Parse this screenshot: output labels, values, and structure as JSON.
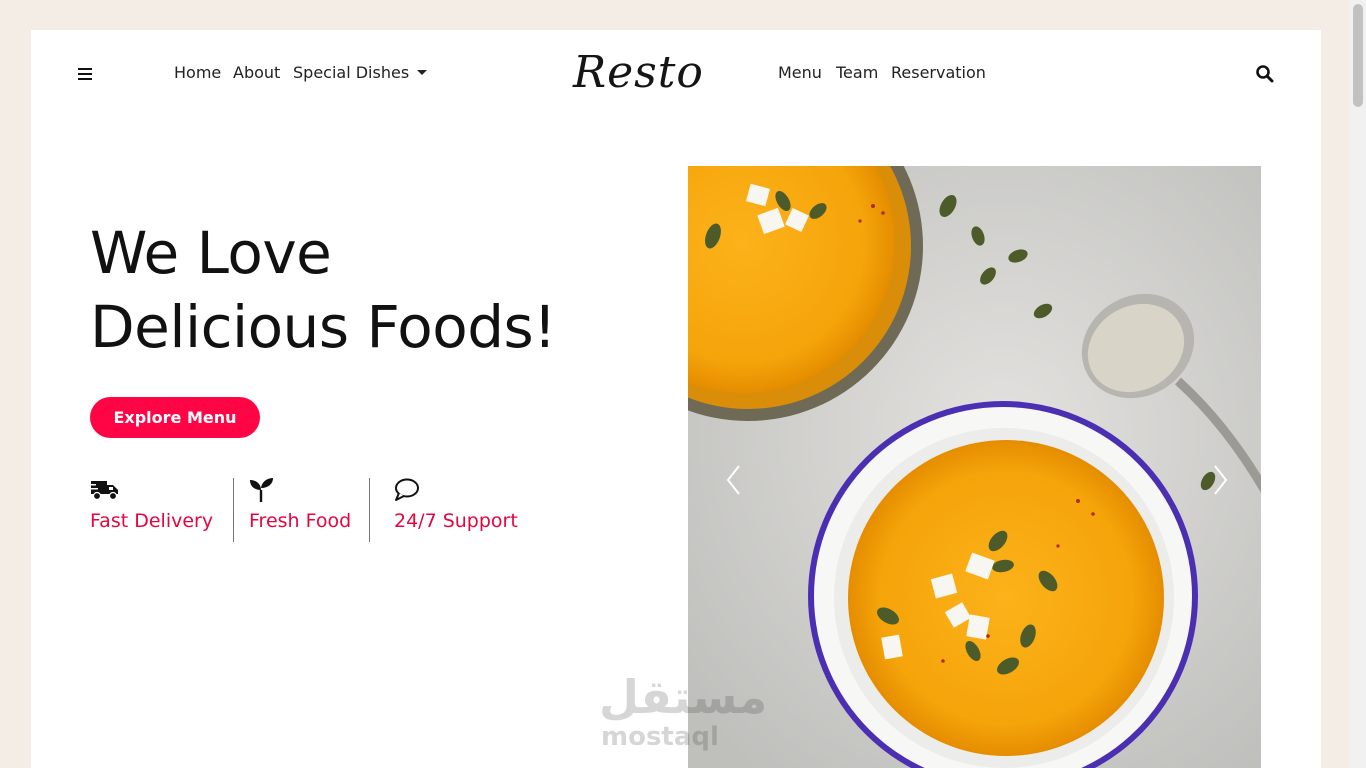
{
  "header": {
    "logo": "Resto",
    "nav_left": [
      "Home",
      "About",
      "Special Dishes"
    ],
    "nav_right": [
      "Menu",
      "Team",
      "Reservation"
    ]
  },
  "hero": {
    "title_line1": "We Love",
    "title_line2": "Delicious Foods!",
    "cta_label": "Explore Menu"
  },
  "features": [
    {
      "icon": "delivery-truck-icon",
      "label": "Fast Delivery"
    },
    {
      "icon": "sprout-icon",
      "label": "Fresh Food"
    },
    {
      "icon": "chat-bubble-icon",
      "label": "24/7 Support"
    }
  ],
  "watermark": {
    "arabic": "مستقل",
    "latin": "mostaql"
  },
  "colors": {
    "accent": "#ff0546",
    "feature_text": "#e7053f",
    "page_bg": "#f3ede6"
  }
}
